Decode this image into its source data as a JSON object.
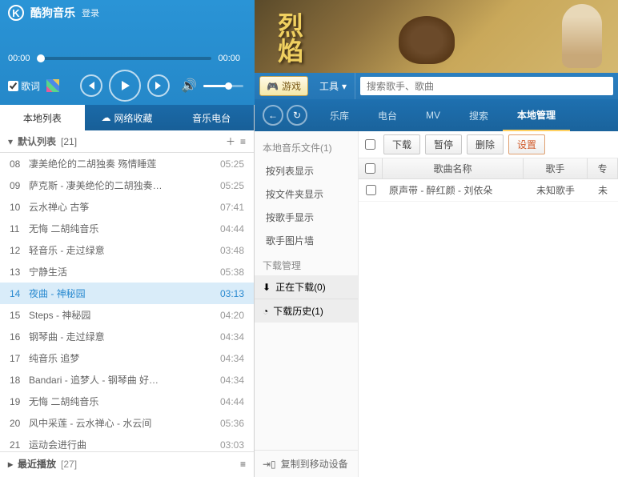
{
  "app": {
    "title": "酷狗音乐",
    "login": "登录"
  },
  "banner": {
    "text": "烈焰"
  },
  "player": {
    "elapsed": "00:00",
    "total": "00:00",
    "lyric_label": "歌词"
  },
  "secbar": {
    "game": "游戏",
    "tools": "工具",
    "search_placeholder": "搜索歌手、歌曲"
  },
  "left_tabs": [
    "本地列表",
    "网络收藏",
    "音乐电台"
  ],
  "playlist_header": {
    "name": "默认列表",
    "count": "[21]"
  },
  "tracks": [
    {
      "num": "08",
      "name": "凄美绝伦的二胡独奏 殇情睡莲",
      "dur": "05:25"
    },
    {
      "num": "09",
      "name": "萨克斯 - 凄美绝伦的二胡独奏…",
      "dur": "05:25"
    },
    {
      "num": "10",
      "name": "云水禅心 古筝",
      "dur": "07:41"
    },
    {
      "num": "11",
      "name": "无悔 二胡纯音乐",
      "dur": "04:44"
    },
    {
      "num": "12",
      "name": "轻音乐 - 走过绿意",
      "dur": "03:48"
    },
    {
      "num": "13",
      "name": "宁静生活",
      "dur": "05:38"
    },
    {
      "num": "14",
      "name": "夜曲 - 神秘园",
      "dur": "03:13",
      "active": true
    },
    {
      "num": "15",
      "name": "Steps - 神秘园",
      "dur": "04:20"
    },
    {
      "num": "16",
      "name": "钢琴曲 - 走过绿意",
      "dur": "04:34"
    },
    {
      "num": "17",
      "name": "纯音乐 追梦",
      "dur": "04:34"
    },
    {
      "num": "18",
      "name": "Bandari - 追梦人 - 钢琴曲 好…",
      "dur": "04:34"
    },
    {
      "num": "19",
      "name": "无悔 二胡纯音乐",
      "dur": "04:44"
    },
    {
      "num": "20",
      "name": "风中采莲 - 云水禅心 - 水云间",
      "dur": "05:36"
    },
    {
      "num": "21",
      "name": "运动会进行曲",
      "dur": "03:03"
    }
  ],
  "playlist_bottom": {
    "name": "最近播放",
    "count": "[27]"
  },
  "nav": [
    "乐库",
    "电台",
    "MV",
    "搜索",
    "本地管理"
  ],
  "side": {
    "head": "本地音乐文件(1)",
    "views": [
      "按列表显示",
      "按文件夹显示",
      "按歌手显示",
      "歌手图片墙"
    ],
    "group": "下载管理",
    "downloading": "正在下载(0)",
    "history": "下载历史(1)",
    "copy": "复制到移动设备"
  },
  "toolbar": {
    "download": "下载",
    "pause": "暂停",
    "delete": "删除",
    "settings": "设置"
  },
  "table": {
    "headers": {
      "title": "歌曲名称",
      "artist": "歌手",
      "extra": "专"
    },
    "rows": [
      {
        "title": "原声带 - 醉红颜 - 刘依朵",
        "artist": "未知歌手",
        "extra": "未"
      }
    ]
  }
}
